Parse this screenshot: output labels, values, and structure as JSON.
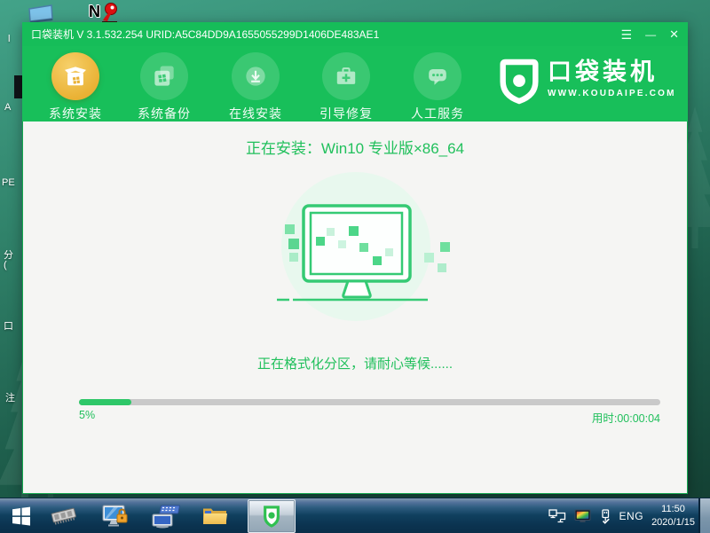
{
  "desktop": {
    "icon_n_label": "N",
    "partial_labels": [
      "l",
      "A",
      "PE",
      "分",
      "(",
      "口",
      "注"
    ]
  },
  "window": {
    "titlebar": {
      "title": "口袋装机 V 3.1.532.254 URID:A5C84DD9A1655055299D1406DE483AE1",
      "menu_icon": "☰",
      "minimize_icon": "—",
      "close_icon": "✕"
    },
    "nav": {
      "items": [
        {
          "label": "系统安装",
          "active": true,
          "icon": "install-box-icon"
        },
        {
          "label": "系统备份",
          "active": false,
          "icon": "backup-windows-icon"
        },
        {
          "label": "在线安装",
          "active": false,
          "icon": "download-icon"
        },
        {
          "label": "引导修复",
          "active": false,
          "icon": "repair-toolbox-icon"
        },
        {
          "label": "人工服务",
          "active": false,
          "icon": "chat-service-icon"
        }
      ]
    },
    "logo": {
      "name": "口袋装机",
      "site": "WWW.KOUDAIPE.COM"
    },
    "main": {
      "installing_title": "正在安装：Win10 专业版×86_64",
      "status_text": "正在格式化分区，请耐心等候......",
      "progress_label": "5%",
      "progress_fill_percent": 9,
      "elapsed": "用时:00:00:04"
    }
  },
  "taskbar": {
    "lang": "ENG",
    "time": "11:50",
    "date": "2020/1/15"
  },
  "colors": {
    "brand_green": "#18bf5a",
    "accent_yellow": "#eab235",
    "text_green": "#21c05c",
    "progress_track": "#c9c9c9",
    "taskbar_blue": "#0b3350"
  }
}
